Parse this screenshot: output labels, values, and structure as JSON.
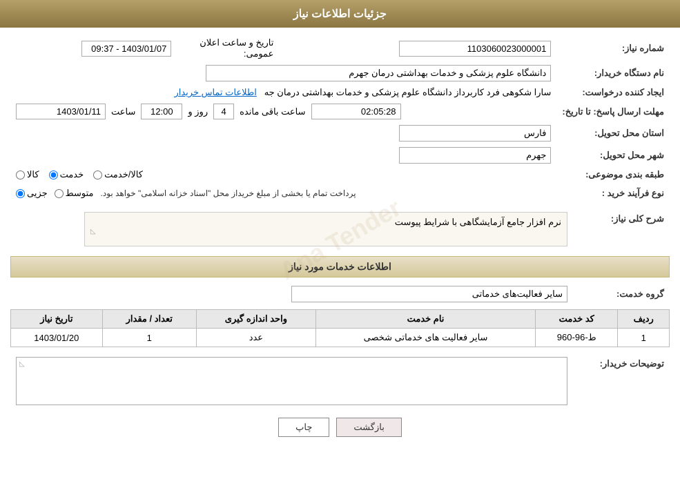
{
  "header": {
    "title": "جزئیات اطلاعات نیاز"
  },
  "fields": {
    "need_number_label": "شماره نیاز:",
    "need_number_value": "1103060023000001",
    "buyer_org_label": "نام دستگاه خریدار:",
    "buyer_org_value": "دانشگاه علوم پزشکی و خدمات بهداشتی  درمان جهرم",
    "creator_label": "ایجاد کننده درخواست:",
    "creator_value": "سارا شکوهی فرد کاربرداز دانشگاه علوم پزشکی و خدمات بهداشتی  درمان جه",
    "creator_link": "اطلاعات تماس خریدار",
    "announce_date_label": "تاریخ و ساعت اعلان عمومی:",
    "announce_date_value": "1403/01/07 - 09:37",
    "deadline_label": "مهلت ارسال پاسخ: تا تاریخ:",
    "deadline_date": "1403/01/11",
    "deadline_time_label": "ساعت",
    "deadline_time": "12:00",
    "deadline_days_label": "روز و",
    "deadline_days": "4",
    "deadline_remaining_label": "ساعت باقی مانده",
    "deadline_remaining": "02:05:28",
    "province_label": "استان محل تحویل:",
    "province_value": "فارس",
    "city_label": "شهر محل تحویل:",
    "city_value": "جهرم",
    "category_label": "طبقه بندی موضوعی:",
    "category_options": [
      "کالا",
      "خدمت",
      "کالا/خدمت"
    ],
    "category_selected": "خدمت",
    "purchase_type_label": "نوع فرآیند خرید :",
    "purchase_type_options": [
      "جزیی",
      "متوسط"
    ],
    "purchase_type_notice": "پرداخت تمام یا بخشی از مبلغ خریداز محل \"اسناد خزانه اسلامی\" خواهد بود.",
    "need_description_section": "شرح کلی نیاز:",
    "need_description_value": "نرم افزار جامع آزمایشگاهی با شرایط پیوست",
    "services_section": "اطلاعات خدمات مورد نیاز",
    "service_group_label": "گروه خدمت:",
    "service_group_value": "سایر فعالیت‌های خدماتی",
    "table": {
      "headers": [
        "ردیف",
        "کد خدمت",
        "نام خدمت",
        "واحد اندازه گیری",
        "تعداد / مقدار",
        "تاریخ نیاز"
      ],
      "rows": [
        {
          "row_num": "1",
          "service_code": "ط-96-960",
          "service_name": "سایر فعالیت های خدماتی شخصی",
          "unit": "عدد",
          "quantity": "1",
          "date": "1403/01/20"
        }
      ]
    },
    "buyer_desc_label": "توضیحات خریدار:",
    "buyer_desc_value": ""
  },
  "buttons": {
    "print": "چاپ",
    "back": "بازگشت"
  }
}
